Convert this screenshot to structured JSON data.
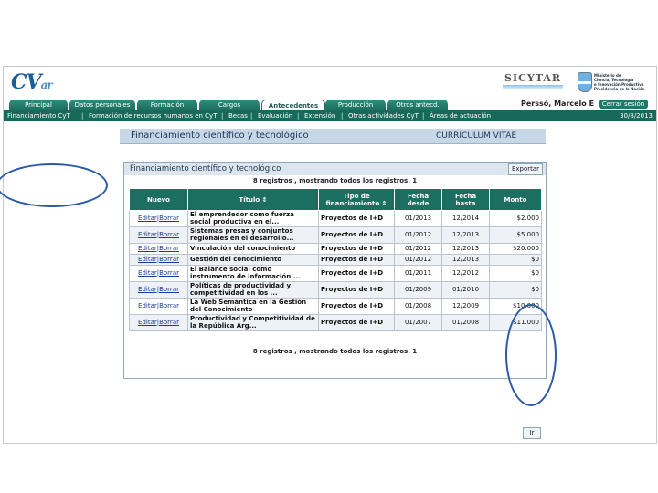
{
  "header": {
    "logo_main": "CV",
    "logo_sub": "ar",
    "brand": "SICYTAR",
    "ministry_lines": [
      "Ministerio de",
      "Ciencia, Tecnología",
      "e Innovación Productiva",
      "Presidencia de la Nación"
    ]
  },
  "tabs": [
    {
      "label": "Principal"
    },
    {
      "label": "Datos personales"
    },
    {
      "label": "Formación"
    },
    {
      "label": "Cargos"
    },
    {
      "label": "Antecedentes",
      "active": true
    },
    {
      "label": "Producción"
    },
    {
      "label": "Otros antecd."
    }
  ],
  "user": {
    "name": "Perssó, Marcelo E"
  },
  "logout_label": "Cerrar sesión",
  "subnav": {
    "items": [
      "Financiamiento CyT",
      "Formación de recursos humanos en CyT",
      "Becas",
      "Evaluación",
      "Extensión",
      "Otras actividades CyT",
      "Áreas de actuación"
    ],
    "date": "30/8/2013"
  },
  "section": {
    "title": "Financiamiento científico y tecnológico",
    "cv_label": "CURRÍCULUM VITAE"
  },
  "panel": {
    "title": "Financiamiento científico y tecnológico",
    "export_label": "Exportar",
    "records_text": "8 registros , mostrando todos los registros. 1",
    "back_label": "Ir"
  },
  "table": {
    "headers": {
      "new": "Nuevo",
      "title": "Título",
      "type": "Tipo de financiamiento",
      "from": "Fecha desde",
      "to": "Fecha hasta",
      "amount": "Monto"
    },
    "sort_glyph": "⇕",
    "edit_label": "Editar|Borrar",
    "rows": [
      {
        "title": "El emprendedor como fuerza social productiva en el...",
        "type": "Proyectos de I+D",
        "from": "01/2013",
        "to": "12/2014",
        "amount": "$2.000"
      },
      {
        "title": "Sistemas presas y conjuntos regionales en el desarrollo...",
        "type": "Proyectos de I+D",
        "from": "01/2012",
        "to": "12/2013",
        "amount": "$5.000"
      },
      {
        "title": "Vinculación del conocimiento",
        "type": "Proyectos de I+D",
        "from": "01/2012",
        "to": "12/2013",
        "amount": "$20.000"
      },
      {
        "title": "Gestión del conocimiento",
        "type": "Proyectos de I+D",
        "from": "01/2012",
        "to": "12/2013",
        "amount": "$0"
      },
      {
        "title": "El Balance social como instrumento de información ...",
        "type": "Proyectos de I+D",
        "from": "01/2011",
        "to": "12/2012",
        "amount": "$0"
      },
      {
        "title": "Políticas de productividad y competitividad en los ...",
        "type": "Proyectos de I+D",
        "from": "01/2009",
        "to": "01/2010",
        "amount": "$0"
      },
      {
        "title": "La Web Semántica en la Gestión del Conocimiento",
        "type": "Proyectos de I+D",
        "from": "01/2008",
        "to": "12/2009",
        "amount": "$10.000"
      },
      {
        "title": "Productividad y Competitividad de la República Arg...",
        "type": "Proyectos de I+D",
        "from": "01/2007",
        "to": "01/2008",
        "amount": "$11.000"
      }
    ]
  },
  "colors": {
    "tab_green": "#1c6b5c",
    "subnav_green": "#17695a",
    "section_blue": "#c7d7e7",
    "annotation": "#2b5aa8"
  }
}
